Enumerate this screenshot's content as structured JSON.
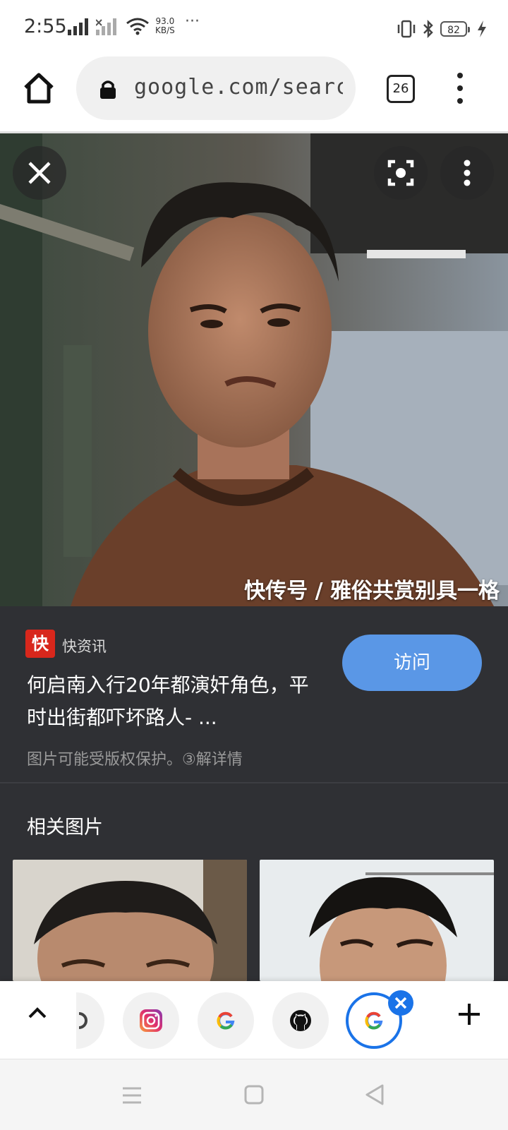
{
  "status_bar": {
    "time": "2:55",
    "speed_value": "93.0",
    "speed_unit": "KB/S",
    "more": "···",
    "battery": "82"
  },
  "toolbar": {
    "url": "google.com/search?q",
    "tab_count": "26"
  },
  "image_viewer": {
    "watermark": "快传号 / 雅俗共赏别具一格"
  },
  "result": {
    "source_name": "快资讯",
    "source_logo_text": "快",
    "title": "何启南入行20年都演奸角色，平时出街都吓坏路人- ...",
    "visit_label": "访问",
    "copyright_note": "图片可能受版权保护。③解详情"
  },
  "related": {
    "title": "相关图片"
  },
  "tab_strip": {
    "tabs": [
      "partial-tab-icon",
      "instagram-icon",
      "google-icon",
      "github-icon",
      "google-icon-active"
    ]
  },
  "colors": {
    "panel_bg": "#2f3034",
    "visit_button": "#5a97e6",
    "active_tab": "#1a73e8"
  }
}
